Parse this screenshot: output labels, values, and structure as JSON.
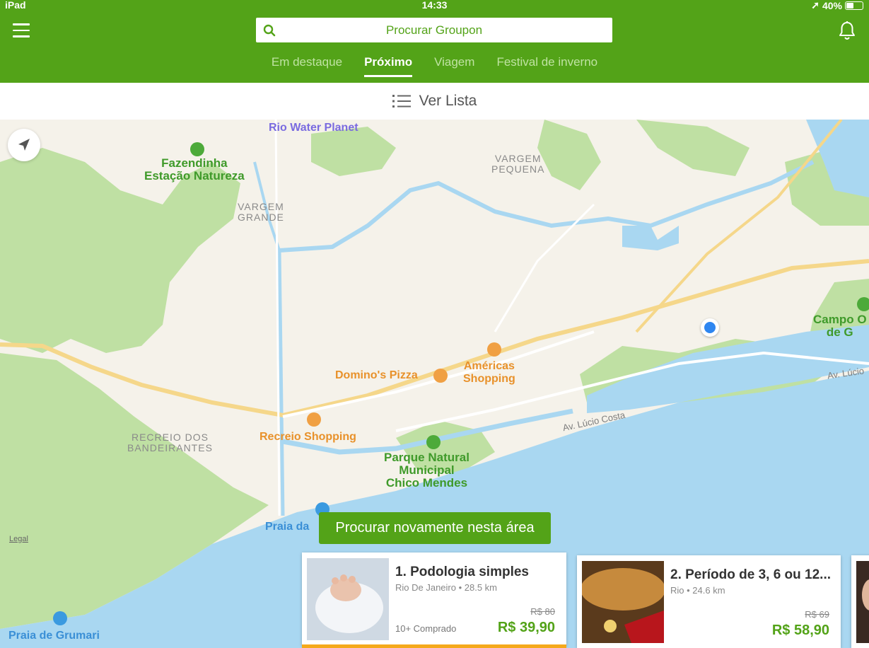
{
  "status_bar": {
    "device": "iPad",
    "time": "14:33",
    "battery": "40%",
    "battery_level": 0.4
  },
  "header": {
    "search_placeholder": "Procurar Groupon",
    "tabs": [
      {
        "label": "Em destaque",
        "active": false
      },
      {
        "label": "Próximo",
        "active": true
      },
      {
        "label": "Viagem",
        "active": false
      },
      {
        "label": "Festival de inverno",
        "active": false
      }
    ]
  },
  "list_bar": {
    "label": "Ver Lista"
  },
  "map": {
    "labels": {
      "rio_water_planet": "Rio Water Planet",
      "fazendinha": "Fazendinha\nEstação Natureza",
      "vargem_pequena": "VARGEM\nPEQUENA",
      "vargem_grande": "VARGEM\nGRANDE",
      "campo": "Campo O\nde G",
      "av_lucio_right": "Av. Lúcio",
      "dominos": "Domino's Pizza",
      "americas": "Américas\nShopping",
      "recreio_dos": "RECREIO DOS\nBANDEIRANTES",
      "recreio_shopping": "Recreio Shopping",
      "av_lucio_costa": "Av. Lúcio Costa",
      "parque": "Parque Natural\nMunicipal\nChico Mendes",
      "praia_da": "Praia da",
      "praia_grumari": "Praia de Grumari"
    },
    "legal": "Legal",
    "research_button": "Procurar novamente nesta área"
  },
  "deals": [
    {
      "title": "1. Podologia simples",
      "location": "Rio De Janeiro • 28.5 km",
      "old_price": "R$ 80",
      "price": "R$ 39,90",
      "bought": "10+ Comprado",
      "selected": true
    },
    {
      "title": "2. Período de 3, 6 ou 12...",
      "location": "Rio • 24.6 km",
      "old_price": "R$ 69",
      "price": "R$ 58,90",
      "bought": "",
      "selected": false
    }
  ],
  "colors": {
    "brand_green": "#53a318",
    "water": "#a9d7f1",
    "land": "#f5f2ea",
    "park": "#bfe0a3",
    "highlight": "#f5a91c"
  }
}
